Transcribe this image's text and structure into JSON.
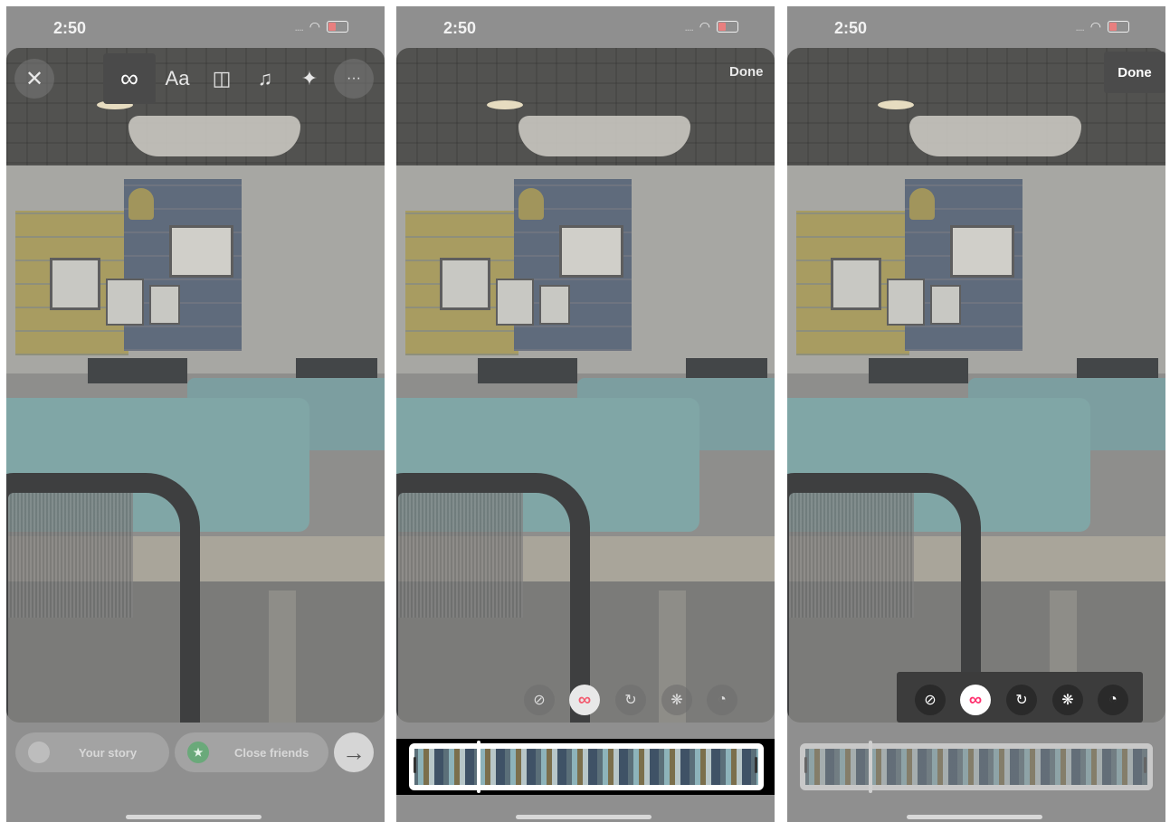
{
  "status_bar": {
    "time": "2:50",
    "signal": "....",
    "wifi_icon": "wifi-icon",
    "battery_icon": "battery-charging-icon"
  },
  "panel1": {
    "close_icon": "close-icon",
    "tools": [
      {
        "name": "boomerang-icon",
        "glyph": "∞",
        "selected": true
      },
      {
        "name": "text-tool-icon",
        "glyph": "Aa",
        "selected": false
      },
      {
        "name": "sticker-icon",
        "glyph": "◫",
        "selected": false
      },
      {
        "name": "music-icon",
        "glyph": "♫",
        "selected": false
      },
      {
        "name": "effects-sparkle-icon",
        "glyph": "✦",
        "selected": false
      }
    ],
    "more_icon": "more-icon",
    "more_glyph": "···",
    "your_story_label": "Your story",
    "close_friends_label": "Close friends",
    "close_friends_star": "★",
    "send_arrow": "→"
  },
  "panel2": {
    "done_label": "Done",
    "modes": [
      {
        "name": "mode-none-icon",
        "glyph": "⊘"
      },
      {
        "name": "mode-classic-icon",
        "glyph": "∞"
      },
      {
        "name": "mode-slowmo-icon",
        "glyph": "↻"
      },
      {
        "name": "mode-echo-icon",
        "glyph": "❋"
      },
      {
        "name": "mode-duo-icon",
        "glyph": "◔"
      }
    ],
    "selected_mode_index": 1
  },
  "panel3": {
    "done_label": "Done",
    "modes": [
      {
        "name": "mode-none-icon",
        "glyph": "⊘"
      },
      {
        "name": "mode-classic-icon",
        "glyph": "∞"
      },
      {
        "name": "mode-slowmo-icon",
        "glyph": "↻"
      },
      {
        "name": "mode-echo-icon",
        "glyph": "❋"
      },
      {
        "name": "mode-duo-icon",
        "glyph": "◔"
      }
    ],
    "selected_mode_index": 1
  },
  "colors": {
    "accent_pink": "#ff2f6e",
    "close_friends_green": "#3fb45b",
    "overlay_gray": "#8f8f8f"
  }
}
